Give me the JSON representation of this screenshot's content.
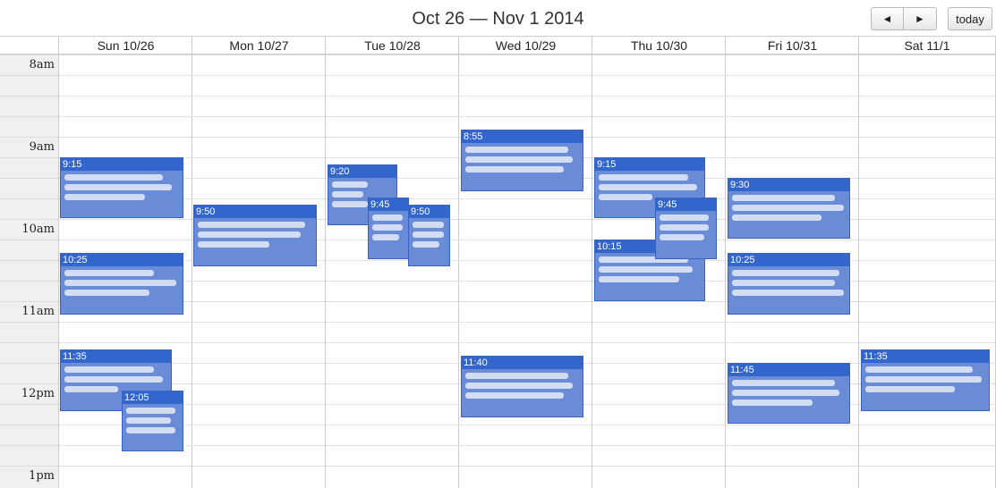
{
  "header": {
    "title": "Oct 26 — Nov 1 2014",
    "prev_label": "◄",
    "next_label": "►",
    "today_label": "today"
  },
  "days": [
    "Sun 10/26",
    "Mon 10/27",
    "Tue 10/28",
    "Wed 10/29",
    "Thu 10/30",
    "Fri 10/31",
    "Sat 11/1"
  ],
  "hours": [
    "8am",
    "9am",
    "10am",
    "11am",
    "12pm",
    "1pm"
  ],
  "events": [
    {
      "day": 0,
      "start": "9:15",
      "label": "9:15"
    },
    {
      "day": 0,
      "start": "10:25",
      "label": "10:25"
    },
    {
      "day": 0,
      "start": "11:35",
      "label": "11:35"
    },
    {
      "day": 0,
      "start": "12:05",
      "label": "12:05"
    },
    {
      "day": 1,
      "start": "9:50",
      "label": "9:50"
    },
    {
      "day": 2,
      "start": "9:20",
      "label": "9:20"
    },
    {
      "day": 2,
      "start": "9:45",
      "label": "9:45"
    },
    {
      "day": 2,
      "start": "9:50",
      "label": "9:50"
    },
    {
      "day": 3,
      "start": "8:55",
      "label": "8:55"
    },
    {
      "day": 3,
      "start": "11:40",
      "label": "11:40"
    },
    {
      "day": 4,
      "start": "9:15",
      "label": "9:15"
    },
    {
      "day": 4,
      "start": "9:45",
      "label": "9:45"
    },
    {
      "day": 4,
      "start": "10:15",
      "label": "10:15"
    },
    {
      "day": 5,
      "start": "9:30",
      "label": "9:30"
    },
    {
      "day": 5,
      "start": "10:25",
      "label": "10:25"
    },
    {
      "day": 5,
      "start": "11:45",
      "label": "11:45"
    },
    {
      "day": 6,
      "start": "11:35",
      "label": "11:35"
    }
  ]
}
